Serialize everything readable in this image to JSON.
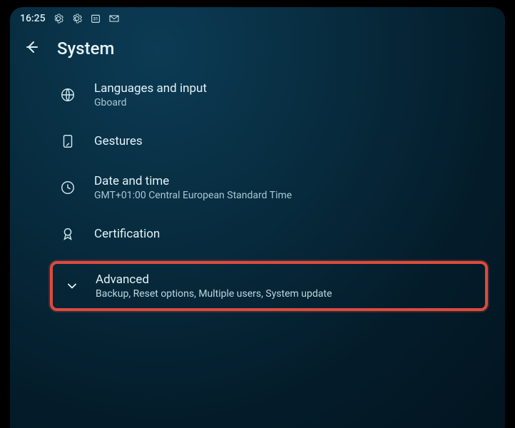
{
  "status": {
    "time": "16:25"
  },
  "header": {
    "title": "System"
  },
  "items": {
    "languages": {
      "label": "Languages and input",
      "sub": "Gboard"
    },
    "gestures": {
      "label": "Gestures"
    },
    "datetime": {
      "label": "Date and time",
      "sub": "GMT+01:00 Central European Standard Time"
    },
    "certification": {
      "label": "Certification"
    },
    "advanced": {
      "label": "Advanced",
      "sub": "Backup, Reset options, Multiple users, System update"
    }
  }
}
